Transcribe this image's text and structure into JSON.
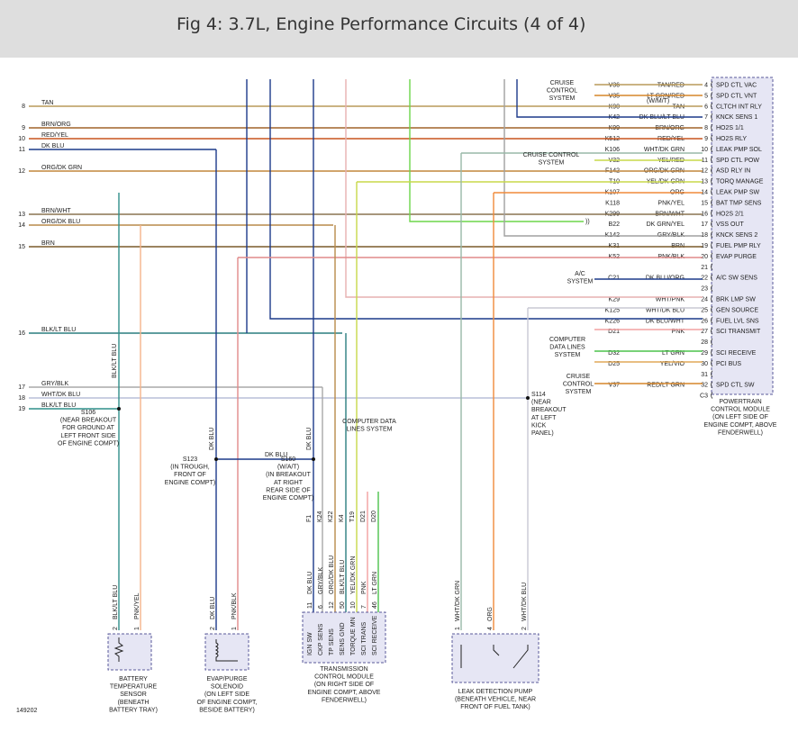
{
  "title": "Fig 4: 3.7L, Engine Performance Circuits (4 of 4)",
  "figure_id": "149202",
  "colors": {
    "tan": "#b89a5a",
    "brn": "#7a5a2a",
    "brn_org": "#a0642a",
    "red_yel": "#c8541e",
    "dk_blu": "#1c3a8a",
    "org_dk_grn": "#c2863c",
    "brn_wht": "#8a7450",
    "org_dk_blu": "#b88a4a",
    "blk_lt_blu": "#2a7d7f",
    "gry_blk": "#a8a8a8",
    "wht_dk_blu": "#b9bfd8",
    "blk_lt_blu2": "#2f8f8a",
    "gry": "#a0a0a0",
    "yel_dk_grn": "#c8d84a",
    "dk_grn_yel": "#6dd64a",
    "lt_grn": "#4cc24c",
    "pnk": "#f2a0a0",
    "pnk_blk": "#e08a8a",
    "org": "#f08a3a",
    "pnk_yel": "#f4b48a",
    "wht_dk_grn": "#98b8a8",
    "wht_dk_blu_side": "#c8c8d4",
    "wht_pnk": "#e6b0b0",
    "red_lt_grn": "#d6862a",
    "yel_vio": "#e0a858",
    "pcm_fill": "#e6e6f4",
    "pcm_border": "#5a5a9a"
  },
  "left_labels": [
    {
      "num": "8",
      "text": "TAN"
    },
    {
      "num": "9",
      "text": "BRN/ORG"
    },
    {
      "num": "10",
      "text": "RED/YEL"
    },
    {
      "num": "11",
      "text": "DK BLU"
    },
    {
      "num": "12",
      "text": "ORG/DK GRN"
    },
    {
      "num": "13",
      "text": "BRN/WHT"
    },
    {
      "num": "14",
      "text": "ORG/DK BLU"
    },
    {
      "num": "15",
      "text": "BRN"
    },
    {
      "num": "16",
      "text": "BLK/LT BLU"
    },
    {
      "num": "17",
      "text": "GRY/BLK"
    },
    {
      "num": "18",
      "text": "WHT/DK BLU"
    },
    {
      "num": "19",
      "text": "BLK/LT BLU"
    }
  ],
  "pcm_pins": [
    {
      "pin": "4",
      "name": "SPD CTL VAC",
      "circuit": "V36",
      "color": "TAN/RED"
    },
    {
      "pin": "5",
      "name": "SPD CTL VNT",
      "circuit": "V35",
      "color": "LT GRN/RED"
    },
    {
      "pin": "6",
      "name": "CLTCH INT RLY",
      "circuit": "K90",
      "color": "TAN"
    },
    {
      "pin": "7",
      "name": "KNCK SENS 1",
      "circuit": "K42",
      "color": "DK BLU/LT BLU"
    },
    {
      "pin": "8",
      "name": "HO2S 1/1",
      "circuit": "K99",
      "color": "BRN/ORG"
    },
    {
      "pin": "9",
      "name": "HO2S RLY",
      "circuit": "K512",
      "color": "RED/YEL"
    },
    {
      "pin": "10",
      "name": "LEAK PMP SOL",
      "circuit": "K106",
      "color": "WHT/DK GRN"
    },
    {
      "pin": "11",
      "name": "SPD CTL POW",
      "circuit": "V32",
      "color": "YEL/RED"
    },
    {
      "pin": "12",
      "name": "ASD RLY IN",
      "circuit": "F142",
      "color": "ORG/DK GRN"
    },
    {
      "pin": "13",
      "name": "TORQ MANAGE",
      "circuit": "T10",
      "color": "YEL/DK GRN"
    },
    {
      "pin": "14",
      "name": "LEAK PMP SW",
      "circuit": "K107",
      "color": "ORG"
    },
    {
      "pin": "15",
      "name": "BAT TMP SENS",
      "circuit": "K118",
      "color": "PNK/YEL"
    },
    {
      "pin": "16",
      "name": "HO2S 2/1",
      "circuit": "K299",
      "color": "BRN/WHT"
    },
    {
      "pin": "17",
      "name": "VSS OUT",
      "circuit": "B22",
      "color": "DK GRN/YEL"
    },
    {
      "pin": "18",
      "name": "KNCK SENS 2",
      "circuit": "K142",
      "color": "GRY/BLK"
    },
    {
      "pin": "19",
      "name": "FUEL PMP RLY",
      "circuit": "K31",
      "color": "BRN"
    },
    {
      "pin": "20",
      "name": "EVAP PURGE",
      "circuit": "K52",
      "color": "PNK/BLK"
    },
    {
      "pin": "21",
      "name": "",
      "circuit": "",
      "color": ""
    },
    {
      "pin": "22",
      "name": "A/C SW SENS",
      "circuit": "C21",
      "color": "DK BLU/ORG"
    },
    {
      "pin": "23",
      "name": "",
      "circuit": "",
      "color": ""
    },
    {
      "pin": "24",
      "name": "BRK LMP SW",
      "circuit": "K29",
      "color": "WHT/PNK"
    },
    {
      "pin": "25",
      "name": "GEN SOURCE",
      "circuit": "K125",
      "color": "WHT/DK BLU"
    },
    {
      "pin": "26",
      "name": "FUEL LVL SNS",
      "circuit": "K226",
      "color": "DK BLU/WHT"
    },
    {
      "pin": "27",
      "name": "SCI TRANSMIT",
      "circuit": "D21",
      "color": "PNK"
    },
    {
      "pin": "28",
      "name": "",
      "circuit": "",
      "color": ""
    },
    {
      "pin": "29",
      "name": "SCI RECEIVE",
      "circuit": "D32",
      "color": "LT GRN"
    },
    {
      "pin": "30",
      "name": "PCI BUS",
      "circuit": "D25",
      "color": "YEL/VIO"
    },
    {
      "pin": "31",
      "name": "",
      "circuit": "",
      "color": ""
    },
    {
      "pin": "32",
      "name": "SPD CTL SW",
      "circuit": "V37",
      "color": "RED/LT GRN"
    },
    {
      "pin": "C3",
      "name": "",
      "circuit": "",
      "color": ""
    }
  ],
  "pcm_label": "POWERTRAIN CONTROL MODULE (ON LEFT SIDE OF ENGINE COMPT, ABOVE FENDERWELL)",
  "pcm_label_lines": [
    "POWERTRAIN",
    "CONTROL MODULE",
    "(ON LEFT SIDE OF",
    "ENGINE COMPT, ABOVE",
    "FENDERWELL)"
  ],
  "wmt_note": "(W/M/T)",
  "systems": {
    "cruise_top": [
      "CRUISE",
      "CONTROL",
      "SYSTEM"
    ],
    "cruise_mid": [
      "CRUISE CONTROL",
      "SYSTEM"
    ],
    "ac_system": [
      "A/C",
      "SYSTEM"
    ],
    "computer_data": [
      "COMPUTER",
      "DATA LINES",
      "SYSTEM"
    ],
    "cruise_bottom": [
      "CRUISE",
      "CONTROL",
      "SYSTEM"
    ],
    "computer_data_vertical": [
      "COMPUTER DATA",
      "LINES SYSTEM"
    ]
  },
  "splices": {
    "s106": [
      "S106",
      "(NEAR BREAKOUT",
      "FOR GROUND AT",
      "LEFT FRONT SIDE",
      "OF ENGINE COMPT)"
    ],
    "s123": [
      "S123",
      "(IN TROUGH,",
      "FRONT OF",
      "ENGINE COMPT)"
    ],
    "s160": [
      "S160",
      "(W/A/T)",
      "(IN BREAKOUT",
      "AT RIGHT",
      "REAR SIDE OF",
      "ENGINE COMPT)"
    ],
    "s114": [
      "S114",
      "(NEAR",
      "BREAKOUT",
      "AT LEFT",
      "KICK",
      "PANEL)"
    ]
  },
  "wire_vertical_labels": {
    "blk_lt_blu": "BLK/LT BLU",
    "dk_blu_a": "DK BLU",
    "dk_blu_b": "DK BLU",
    "dk_blu_h": "DK BLU",
    "f1": "F1",
    "k24": "K24",
    "k22": "K22",
    "k4": "K4",
    "t19": "T19",
    "d21": "D21",
    "d20": "D20"
  },
  "tcm_wires": [
    {
      "pin": "11",
      "color": "DK BLU",
      "name": "IGN SW"
    },
    {
      "pin": "6",
      "color": "GRY/BLK",
      "name": "CKP SENS"
    },
    {
      "pin": "12",
      "color": "ORG/DK BLU",
      "name": "TP SENS"
    },
    {
      "pin": "50",
      "color": "BLK/LT BLU",
      "name": "SENS GND"
    },
    {
      "pin": "10",
      "color": "YEL/DK GRN",
      "name": "TORQUE MN"
    },
    {
      "pin": "7",
      "color": "PNK",
      "name": "SCI TRANS"
    },
    {
      "pin": "46",
      "color": "LT GRN",
      "name": "SCI RECEIVE"
    }
  ],
  "tcm_label": [
    "TRANSMISSION",
    "CONTROL MODULE",
    "(ON RIGHT SIDE OF",
    "ENGINE COMPT, ABOVE",
    "FENDERWELL)"
  ],
  "battery_temp": {
    "pins": [
      "2",
      "1"
    ],
    "wires": [
      "BLK/LT BLU",
      "PNK/YEL"
    ],
    "label": [
      "BATTERY",
      "TEMPERATURE",
      "SENSOR",
      "(BENEATH",
      "BATTERY TRAY)"
    ]
  },
  "evap": {
    "pins": [
      "2",
      "1"
    ],
    "wires": [
      "DK BLU",
      "PNK/BLK"
    ],
    "label": [
      "EVAP/PURGE",
      "SOLENOID",
      "(ON LEFT SIDE",
      "OF ENGINE COMPT,",
      "BESIDE BATTERY)"
    ]
  },
  "leak_pump": {
    "pins": [
      "1",
      "4",
      "2"
    ],
    "wires": [
      "WHT/DK GRN",
      "ORG",
      "WHT/DK BLU"
    ],
    "label": [
      "LEAK DETECTION PUMP",
      "(BENEATH VEHICLE, NEAR",
      "FRONT OF FUEL TANK)"
    ]
  }
}
